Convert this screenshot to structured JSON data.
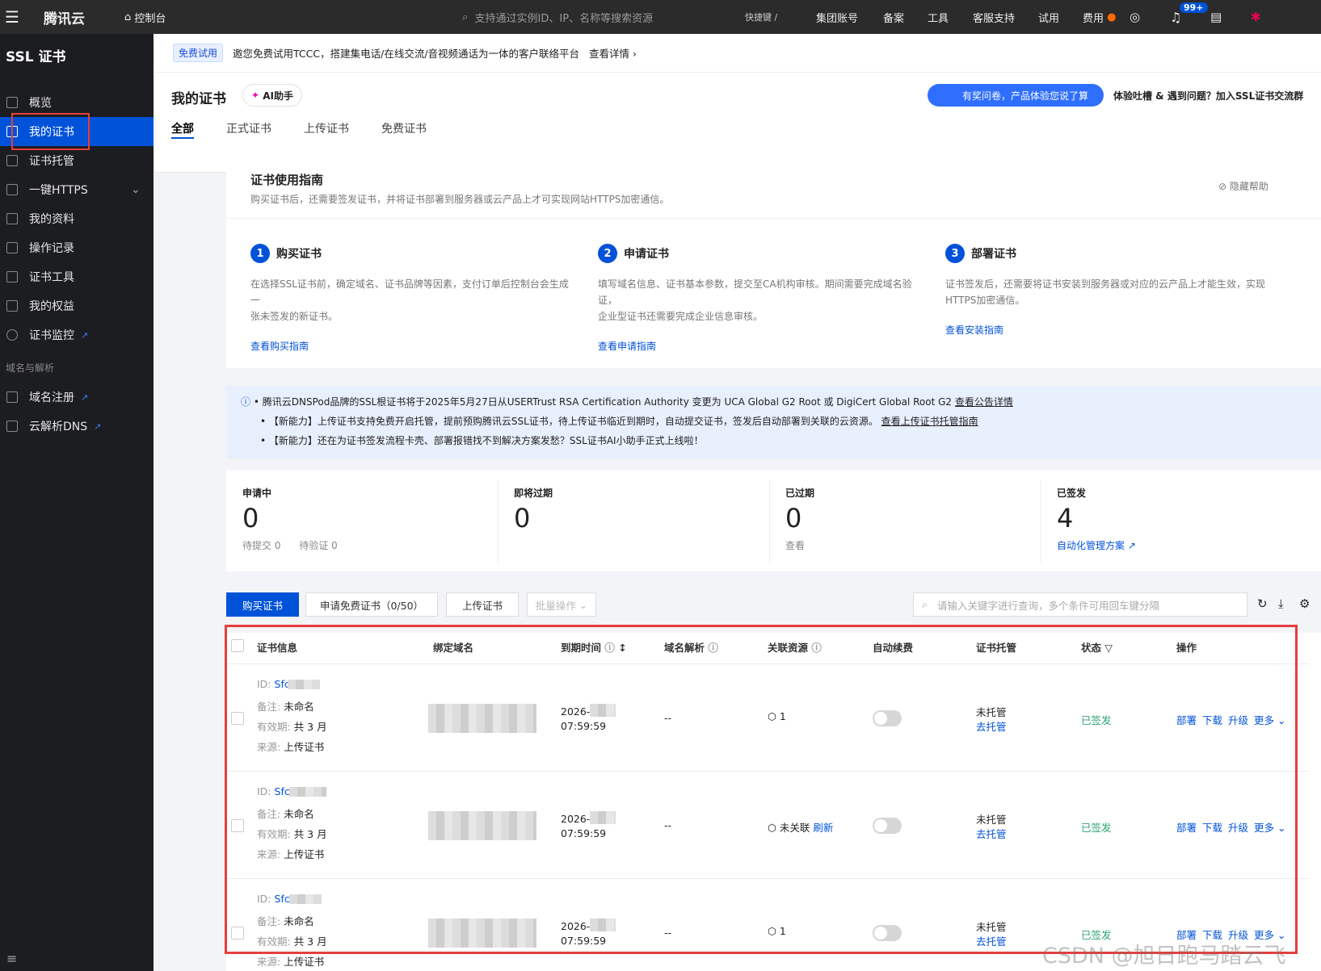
{
  "topbar": {
    "logo": "腾讯云",
    "console": "控制台",
    "search_placeholder": "支持通过实例ID、IP、名称等搜索资源",
    "shortcut": "快捷键 /",
    "menu": [
      "集团账号",
      "备案",
      "工具",
      "客服支持",
      "试用",
      "费用"
    ],
    "badge": "99+"
  },
  "sidebar": {
    "title": "SSL 证书",
    "items": [
      "概览",
      "我的证书",
      "证书托管",
      "一键HTTPS",
      "我的资料",
      "操作记录",
      "证书工具",
      "我的权益",
      "证书监控"
    ],
    "section": "域名与解析",
    "items2": [
      "域名注册",
      "云解析DNS"
    ]
  },
  "banner": {
    "pill": "免费试用",
    "text": "邀您免费试用TCCC，搭建集电话/在线交流/音视频通话为一体的客户联络平台",
    "link": "查看详情 ›"
  },
  "header": {
    "title": "我的证书",
    "ai": "AI助手",
    "promo": "有奖问卷，产品体验您说了算",
    "feedback": "体验吐槽 & 遇到问题？加入SSL证书交流群",
    "tabs": [
      "全部",
      "正式证书",
      "上传证书",
      "免费证书"
    ]
  },
  "guide": {
    "title": "证书使用指南",
    "desc": "购买证书后，还需要签发证书，并将证书部署到服务器或云产品上才可实现网站HTTPS加密通信。",
    "hide": "隐藏帮助",
    "steps": [
      {
        "num": "1",
        "title": "购买证书",
        "desc1": "在选择SSL证书前，确定域名、证书品牌等因素，支付订单后控制台会生成一",
        "desc2": "张未签发的新证书。",
        "link": "查看购买指南"
      },
      {
        "num": "2",
        "title": "申请证书",
        "desc1": "填写域名信息、证书基本参数，提交至CA机构审核。期间需要完成域名验证，",
        "desc2": "企业型证书还需要完成企业信息审核。",
        "link": "查看申请指南"
      },
      {
        "num": "3",
        "title": "部署证书",
        "desc1": "证书签发后，还需要将证书安装到服务器或对应的云产品上才能生效，实现",
        "desc2": "HTTPS加密通信。",
        "link": "查看安装指南"
      }
    ]
  },
  "notice": [
    "腾讯云DNSPod品牌的SSL根证书将于2025年5月27日从USERTrust RSA Certification Authority 变更为 UCA Global G2 Root 或 DigiCert Global Root G2",
    "查看公告详情",
    "【新能力】上传证书支持免费开启托管，提前预购腾讯云SSL证书，待上传证书临近到期时，自动提交证书，签发后自动部署到关联的云资源。",
    "查看上传证书托管指南",
    "【新能力】还在为证书签发流程卡壳、部署报错找不到解决方案发愁？SSL证书AI小助手正式上线啦！"
  ],
  "stats": [
    {
      "label": "申请中",
      "value": "0",
      "sub1": "待提交 0",
      "sub2": "待验证 0"
    },
    {
      "label": "即将过期",
      "value": "0"
    },
    {
      "label": "已过期",
      "value": "0",
      "sub1": "查看"
    },
    {
      "label": "已签发",
      "value": "4",
      "sub1": "自动化管理方案"
    }
  ],
  "toolbar": {
    "buy": "购买证书",
    "apply": "申请免费证书（0/50）",
    "upload": "上传证书",
    "batch": "批量操作",
    "search_placeholder": "请输入关键字进行查询，多个条件可用回车键分隔"
  },
  "table": {
    "headers": [
      "证书信息",
      "绑定域名",
      "到期时间",
      "域名解析",
      "关联资源",
      "自动续费",
      "证书托管",
      "状态",
      "操作"
    ],
    "rows": [
      {
        "id": "Sfc",
        "remark": "未命名",
        "validity": "共 3 月",
        "source": "上传证书",
        "expire1": "2026-",
        "expire2": "07:59:59",
        "dns": "--",
        "res": "1",
        "trust": "未托管",
        "trust_link": "去托管",
        "status": "已签发"
      },
      {
        "id": "Sfc",
        "remark": "未命名",
        "validity": "共 3 月",
        "source": "上传证书",
        "expire1": "2026-",
        "expire2": "07:59:59",
        "dns": "--",
        "res": "未关联",
        "res_link": "刷新",
        "trust": "未托管",
        "trust_link": "去托管",
        "status": "已签发"
      },
      {
        "id": "Sfc",
        "remark": "未命名",
        "validity": "共 3 月",
        "source": "上传证书",
        "expire1": "2026-",
        "expire2": "07:59:59",
        "dns": "--",
        "res": "1",
        "trust": "未托管",
        "trust_link": "去托管",
        "status": "已签发"
      }
    ],
    "labels": {
      "id": "ID:",
      "remark": "备注:",
      "validity": "有效期:",
      "source": "来源:"
    },
    "actions": [
      "部署",
      "下载",
      "升级",
      "更多"
    ]
  },
  "watermark": "CSDN @旭日跑马踏云飞"
}
